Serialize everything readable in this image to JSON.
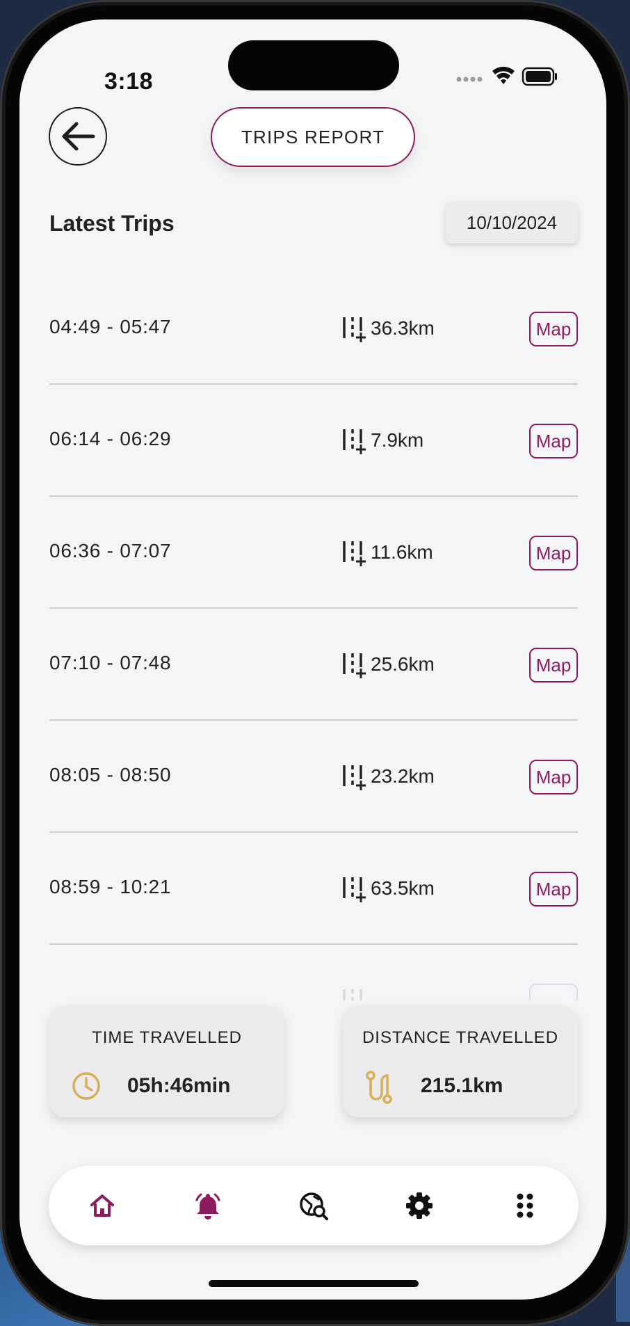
{
  "status_bar": {
    "time": "3:18"
  },
  "header": {
    "title": "TRIPS REPORT"
  },
  "trips_section": {
    "title": "Latest Trips",
    "date": "10/10/2024"
  },
  "trips": [
    {
      "time_range": "04:49 - 05:47",
      "distance": "36.3km",
      "action": "Map"
    },
    {
      "time_range": "06:14 - 06:29",
      "distance": "7.9km",
      "action": "Map"
    },
    {
      "time_range": "06:36 - 07:07",
      "distance": "11.6km",
      "action": "Map"
    },
    {
      "time_range": "07:10 - 07:48",
      "distance": "25.6km",
      "action": "Map"
    },
    {
      "time_range": "08:05 - 08:50",
      "distance": "23.2km",
      "action": "Map"
    },
    {
      "time_range": "08:59 - 10:21",
      "distance": "63.5km",
      "action": "Map"
    }
  ],
  "summary": {
    "time": {
      "label": "TIME TRAVELLED",
      "value": "05h:46min",
      "icon": "clock-icon"
    },
    "distance": {
      "label": "DISTANCE TRAVELLED",
      "value": "215.1km",
      "icon": "route-icon"
    }
  },
  "bottom_nav": {
    "items": [
      {
        "icon": "home-icon",
        "active": true
      },
      {
        "icon": "bell-icon",
        "active": true
      },
      {
        "icon": "globe-search-icon",
        "active": false
      },
      {
        "icon": "gear-icon",
        "active": false
      },
      {
        "icon": "grid-icon",
        "active": false
      }
    ]
  },
  "colors": {
    "accent": "#8d1b5d",
    "summary_icon": "#d9b05a",
    "background": "#f4f5f7",
    "text": "#222222"
  }
}
